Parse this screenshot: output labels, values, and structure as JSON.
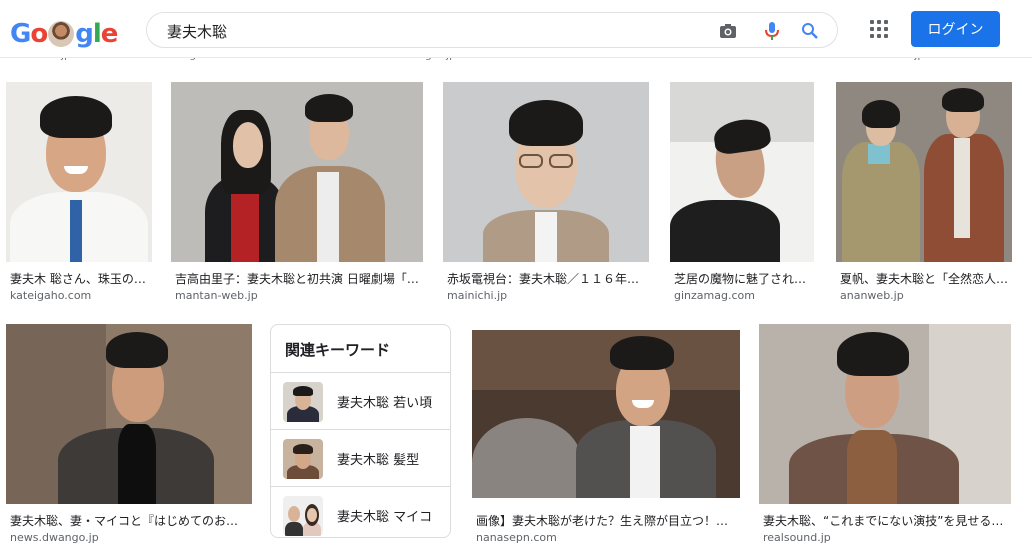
{
  "header": {
    "logo_text": "Google",
    "search_value": "妻夫木聡",
    "login_label": "ログイン"
  },
  "top_strip": [
    "mamieru.jp",
    "cigarcom",
    "mamagirl.jp",
    "dewdawn.com",
    "enewtd.jp"
  ],
  "results_row1": [
    {
      "caption": "妻夫木 聡さん、珠玉の…",
      "source": "kateigaho.com"
    },
    {
      "caption": "吉高由里子：妻夫木聡と初共演 日曜劇場「…",
      "source": "mantan-web.jp"
    },
    {
      "caption": "赤坂電視台：妻夫木聡／１１６年…",
      "source": "mainichi.jp"
    },
    {
      "caption": "芝居の魔物に魅了され…",
      "source": "ginzamag.com"
    },
    {
      "caption": "夏帆、妻夫木聡と「全然恋人…",
      "source": "ananweb.jp"
    }
  ],
  "results_row2": [
    {
      "caption": "妻夫木聡、妻・マイコと『はじめてのお…",
      "source": "news.dwango.jp"
    },
    {
      "caption": "画像】妻夫木聡が老けた？生え際が目立つ！…",
      "source": "nanasepn.com"
    },
    {
      "caption": "妻夫木聡、“これまでにない演技”を見せる…",
      "source": "realsound.jp"
    }
  ],
  "related": {
    "title": "関連キーワード",
    "items": [
      {
        "label": "妻夫木聡 若い頃"
      },
      {
        "label": "妻夫木聡 髪型"
      },
      {
        "label": "妻夫木聡 マイコ"
      }
    ]
  },
  "colors": {
    "accent": "#1a73e8",
    "text": "#202124",
    "secondary": "#5f6368"
  }
}
